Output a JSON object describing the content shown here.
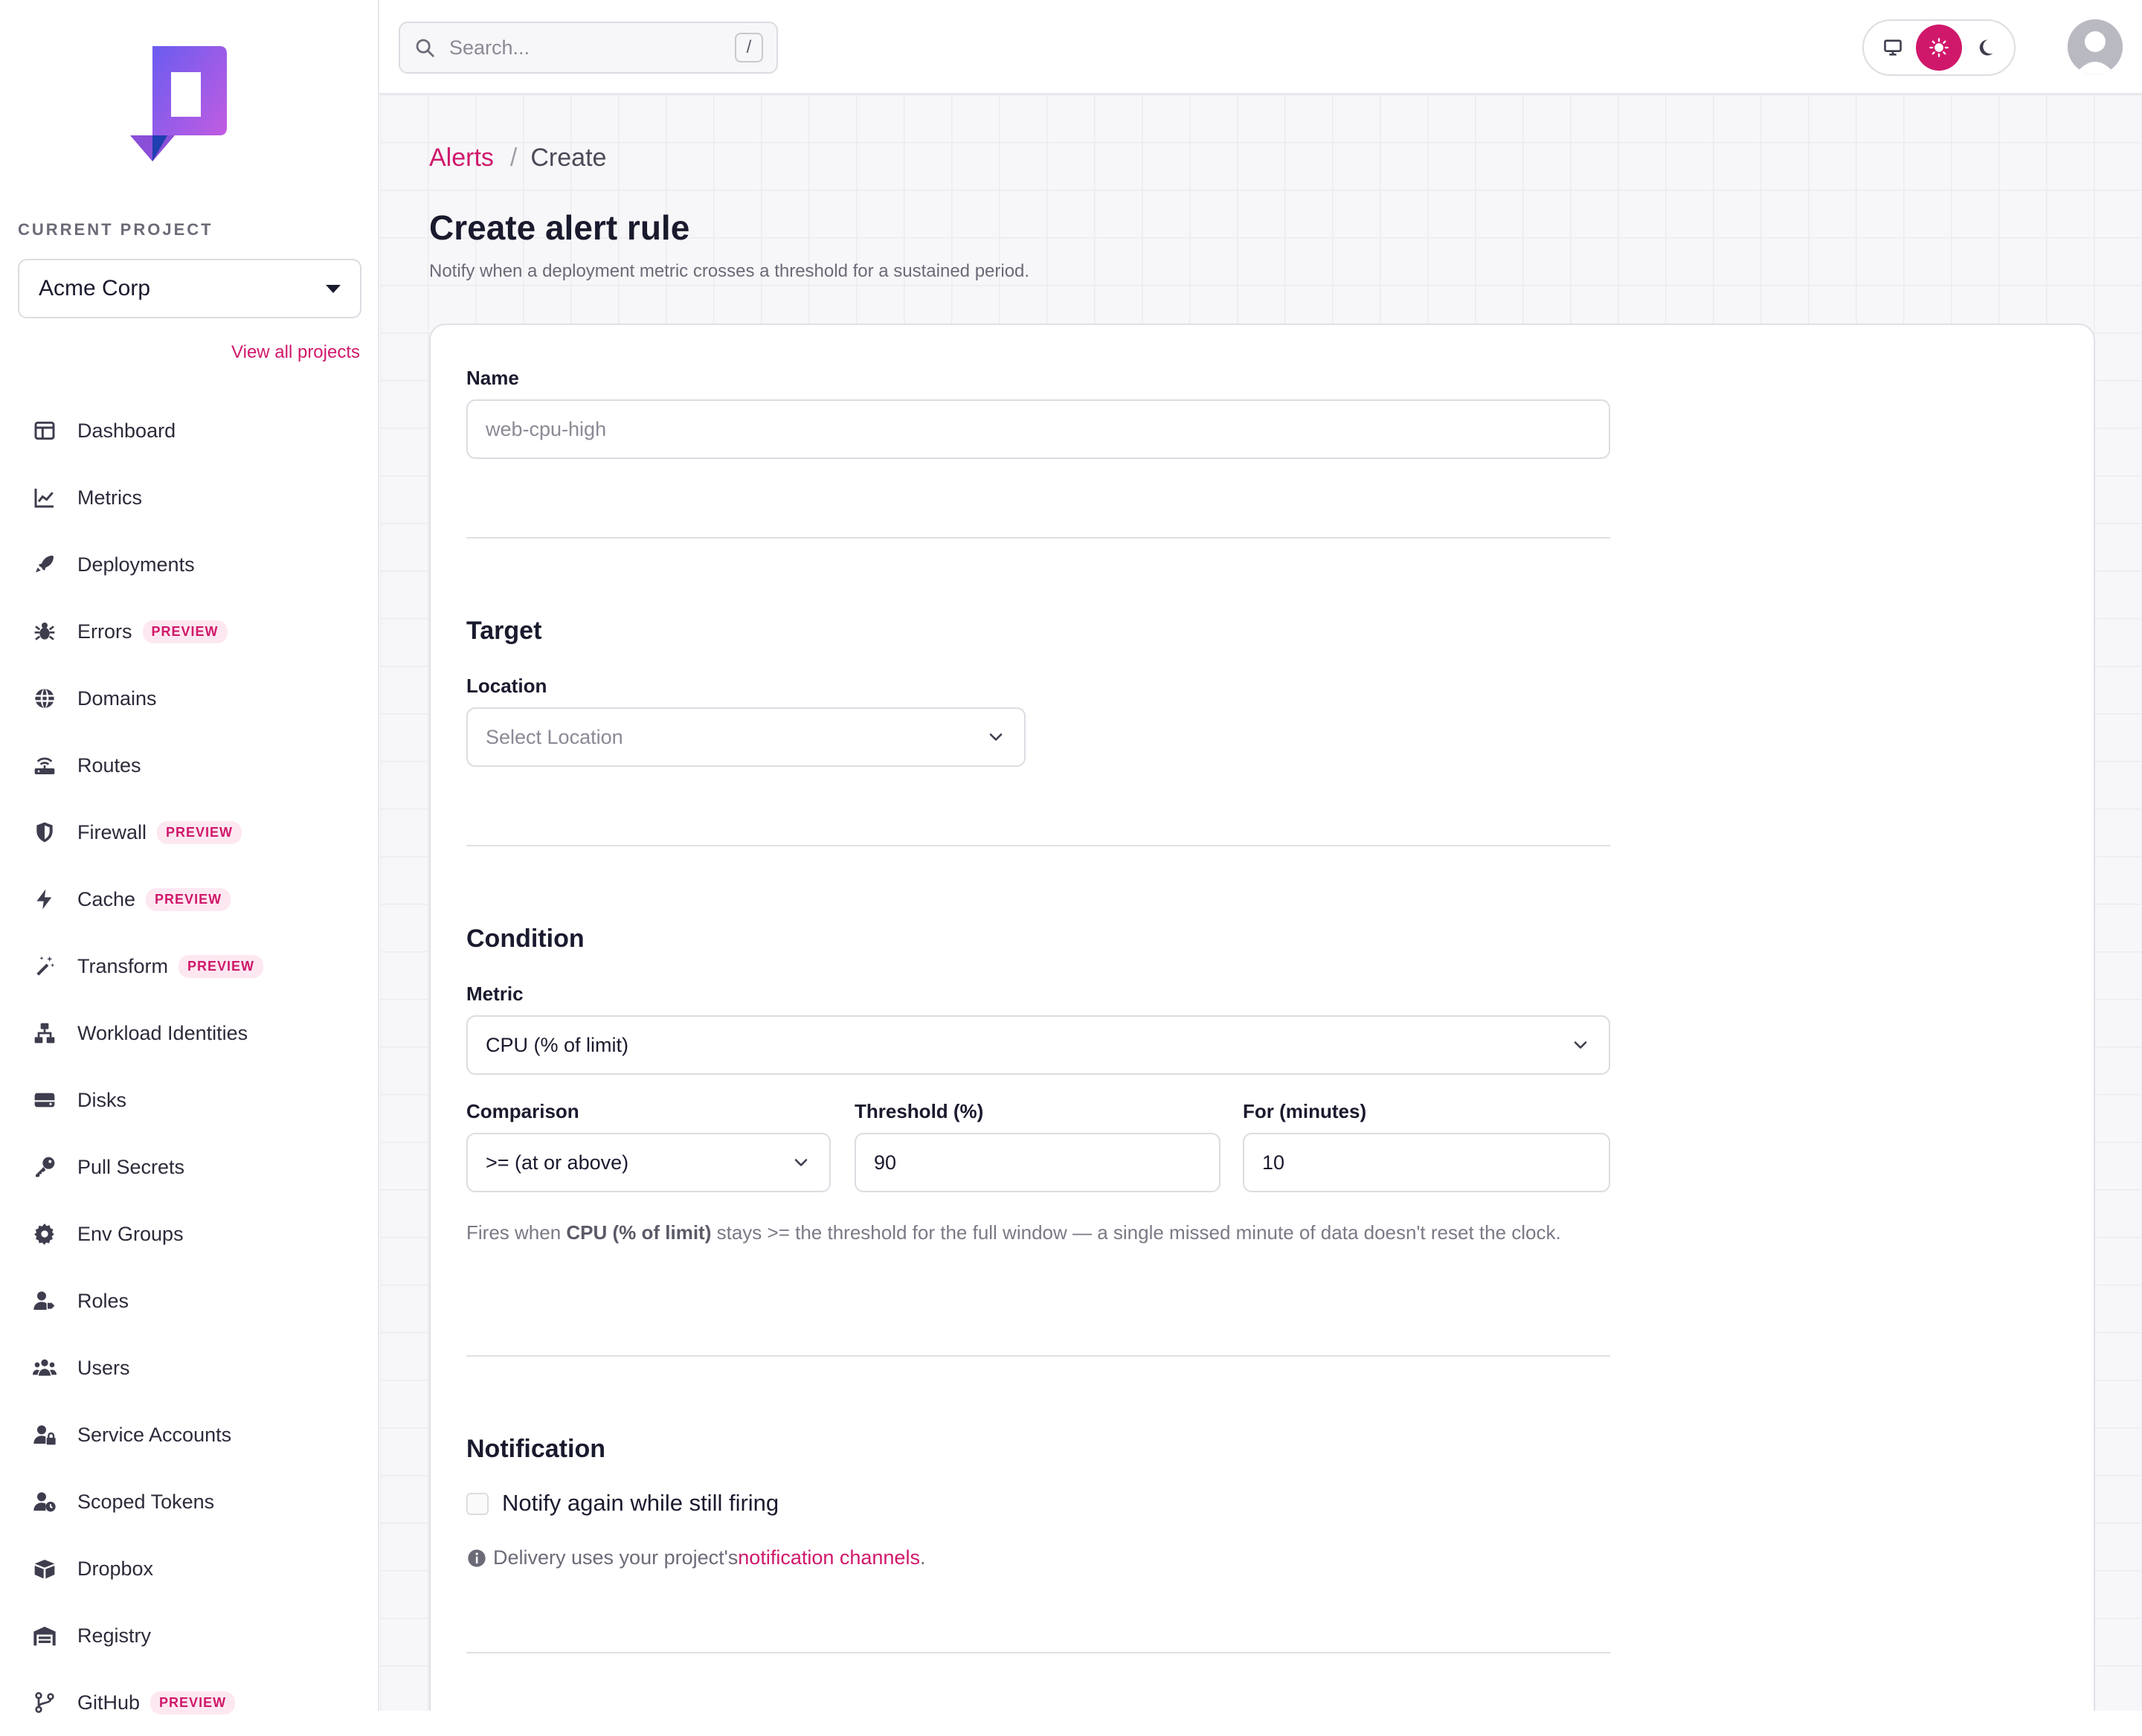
{
  "sidebar": {
    "current_project_label": "CURRENT PROJECT",
    "project_name": "Acme Corp",
    "view_all": "View all projects",
    "items": [
      {
        "label": "Dashboard",
        "icon": "dashboard-icon",
        "badge": ""
      },
      {
        "label": "Metrics",
        "icon": "chart-icon",
        "badge": ""
      },
      {
        "label": "Deployments",
        "icon": "rocket-icon",
        "badge": ""
      },
      {
        "label": "Errors",
        "icon": "bug-icon",
        "badge": "PREVIEW"
      },
      {
        "label": "Domains",
        "icon": "globe-icon",
        "badge": ""
      },
      {
        "label": "Routes",
        "icon": "router-icon",
        "badge": ""
      },
      {
        "label": "Firewall",
        "icon": "shield-icon",
        "badge": "PREVIEW"
      },
      {
        "label": "Cache",
        "icon": "bolt-icon",
        "badge": "PREVIEW"
      },
      {
        "label": "Transform",
        "icon": "magic-wand-icon",
        "badge": "PREVIEW"
      },
      {
        "label": "Workload Identities",
        "icon": "network-icon",
        "badge": ""
      },
      {
        "label": "Disks",
        "icon": "disk-icon",
        "badge": ""
      },
      {
        "label": "Pull Secrets",
        "icon": "key-icon",
        "badge": ""
      },
      {
        "label": "Env Groups",
        "icon": "gear-icon",
        "badge": ""
      },
      {
        "label": "Roles",
        "icon": "user-tag-icon",
        "badge": ""
      },
      {
        "label": "Users",
        "icon": "users-icon",
        "badge": ""
      },
      {
        "label": "Service Accounts",
        "icon": "user-lock-icon",
        "badge": ""
      },
      {
        "label": "Scoped Tokens",
        "icon": "user-clock-icon",
        "badge": ""
      },
      {
        "label": "Dropbox",
        "icon": "box-icon",
        "badge": ""
      },
      {
        "label": "Registry",
        "icon": "warehouse-icon",
        "badge": ""
      },
      {
        "label": "GitHub",
        "icon": "branch-icon",
        "badge": "PREVIEW"
      }
    ]
  },
  "topbar": {
    "search_placeholder": "Search...",
    "search_shortcut": "/",
    "theme_options": [
      "system",
      "light",
      "dark"
    ],
    "theme_active": "light"
  },
  "breadcrumb": {
    "parent": "Alerts",
    "separator": "/",
    "current": "Create"
  },
  "page": {
    "title": "Create alert rule",
    "subtitle": "Notify when a deployment metric crosses a threshold for a sustained period."
  },
  "form": {
    "name": {
      "label": "Name",
      "placeholder": "web-cpu-high",
      "value": ""
    },
    "target": {
      "title": "Target",
      "location": {
        "label": "Location",
        "placeholder": "Select Location"
      }
    },
    "condition": {
      "title": "Condition",
      "metric": {
        "label": "Metric",
        "value": "CPU (% of limit)"
      },
      "comparison": {
        "label": "Comparison",
        "value": ">= (at or above)"
      },
      "threshold": {
        "label": "Threshold (%)",
        "value": "90"
      },
      "for_minutes": {
        "label": "For (minutes)",
        "value": "10"
      },
      "help_prefix": "Fires when ",
      "help_metric": "CPU (% of limit)",
      "help_suffix": " stays >= the threshold for the full window — a single missed minute of data doesn't reset the clock."
    },
    "notification": {
      "title": "Notification",
      "renotify_label": "Notify again while still firing",
      "renotify_checked": false,
      "info_prefix": "Delivery uses your project's ",
      "info_link": "notification channels",
      "info_suffix": "."
    }
  },
  "colors": {
    "accent": "#d0186b",
    "logo_gradient_start": "#6a5cf0",
    "logo_gradient_end": "#c85ce0"
  }
}
